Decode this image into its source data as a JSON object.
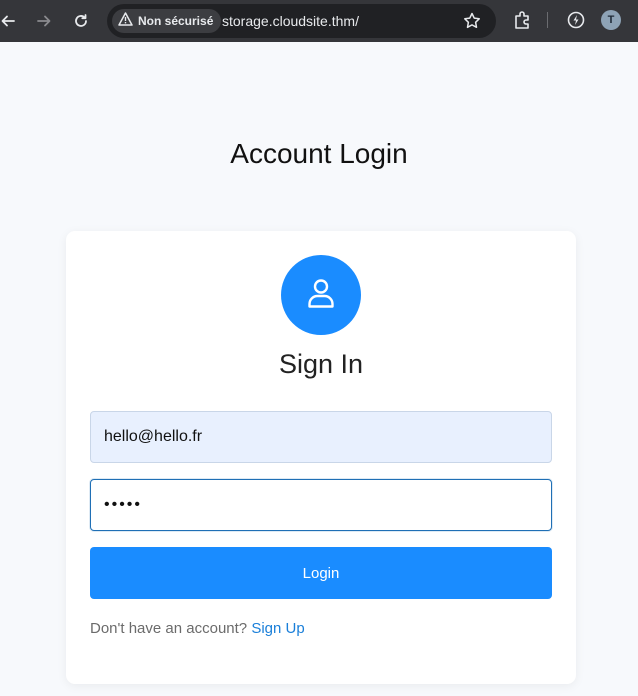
{
  "browser": {
    "security_label": "Non sécurisé",
    "url": "storage.cloudsite.thm/",
    "profile_initial": "T"
  },
  "page": {
    "title": "Account Login"
  },
  "login_form": {
    "heading": "Sign In",
    "email_value": "hello@hello.fr",
    "password_value": "•••••",
    "login_label": "Login",
    "signup_prompt": "Don't have an account?",
    "signup_link": "Sign Up"
  },
  "colors": {
    "primary": "#1a8cff",
    "link": "#1a7fd9",
    "autofill_bg": "#e8f0fe",
    "page_bg": "#f7f9fc",
    "chrome_bg": "#35363a"
  },
  "icons": {
    "back": "arrow-left-icon",
    "forward": "arrow-right-icon",
    "reload": "reload-icon",
    "security": "warning-triangle-icon",
    "bookmark": "star-icon",
    "extensions": "puzzle-icon",
    "performance": "performance-icon",
    "user": "user-icon"
  }
}
